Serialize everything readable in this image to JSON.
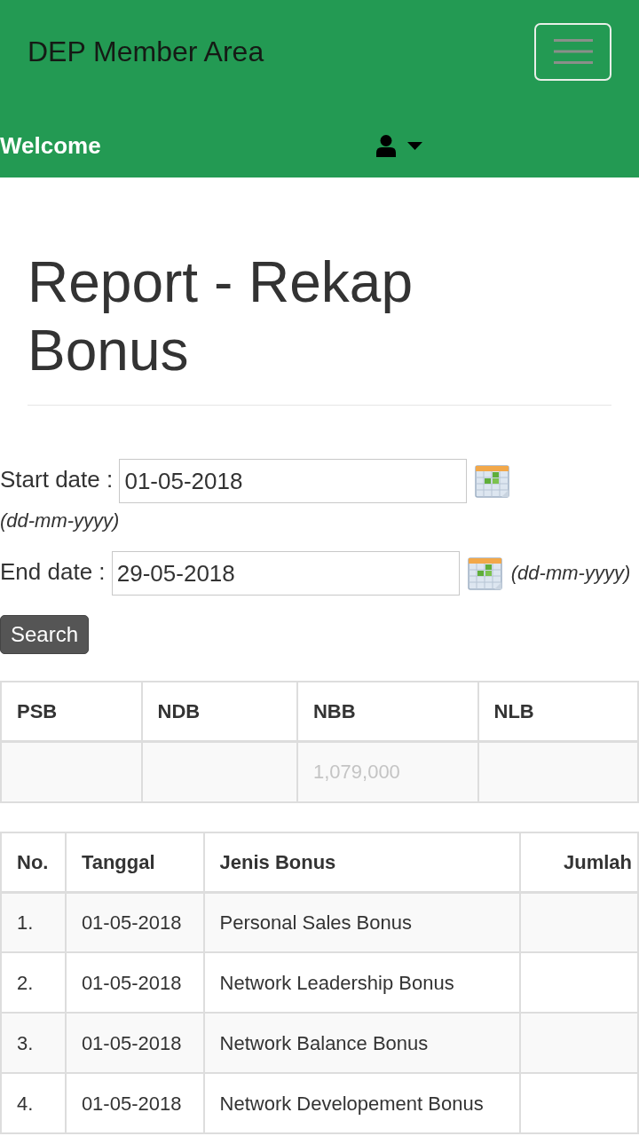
{
  "navbar": {
    "brand": "DEP Member Area",
    "welcome": "Welcome"
  },
  "page": {
    "title": "Report - Rekap Bonus"
  },
  "filters": [
    {
      "label": "Start date :",
      "value": "01-05-2018",
      "format_note": "(dd-mm-yyyy)"
    },
    {
      "label": "End date :",
      "value": "29-05-2018",
      "format_note": "(dd-mm-yyyy)"
    }
  ],
  "search_button": "Search",
  "summary": {
    "cells": [
      {
        "header": "PSB"
      },
      {
        "header": "NDB"
      },
      {
        "header": "NBB",
        "value": "1,079,000"
      },
      {
        "header": "NLB"
      }
    ]
  },
  "bonus_table": {
    "columns": [
      "No.",
      "Tanggal",
      "Jenis Bonus",
      "Jumlah"
    ],
    "rows": [
      {
        "no": "1.",
        "date": "01-05-2018",
        "type": "Personal Sales Bonus"
      },
      {
        "no": "2.",
        "date": "01-05-2018",
        "type": "Network Leadership Bonus"
      },
      {
        "no": "3.",
        "date": "01-05-2018",
        "type": "Network Balance Bonus"
      },
      {
        "no": "4.",
        "date": "01-05-2018",
        "type": "Network Developement Bonus"
      }
    ]
  }
}
